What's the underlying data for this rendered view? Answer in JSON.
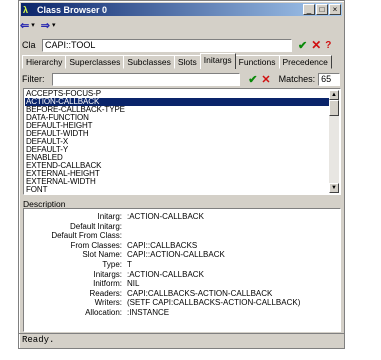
{
  "window": {
    "title": "Class Browser 0",
    "icon": "lambda-icon"
  },
  "class_field": {
    "label": "Cla",
    "value": "CAPI::TOOL"
  },
  "tabs": [
    "Hierarchy",
    "Superclasses",
    "Subclasses",
    "Slots",
    "Initargs",
    "Functions",
    "Precedence"
  ],
  "active_tab": "Initargs",
  "filter": {
    "label": "Filter:",
    "value": "",
    "matches_label": "Matches:",
    "matches_value": "65"
  },
  "initargs": [
    "ACCEPTS-FOCUS-P",
    "ACTION-CALLBACK",
    "BEFORE-CALLBACK-TYPE",
    "DATA-FUNCTION",
    "DEFAULT-HEIGHT",
    "DEFAULT-WIDTH",
    "DEFAULT-X",
    "DEFAULT-Y",
    "ENABLED",
    "EXTEND-CALLBACK",
    "EXTERNAL-HEIGHT",
    "EXTERNAL-WIDTH",
    "FONT"
  ],
  "selected_index": 1,
  "description": {
    "label": "Description",
    "rows": [
      {
        "key": "Initarg",
        "value": ":ACTION-CALLBACK"
      },
      {
        "key": "Default Initarg",
        "value": ""
      },
      {
        "key": "Default From Class",
        "value": ""
      },
      {
        "key": "From Classes",
        "value": "CAPI::CALLBACKS"
      },
      {
        "key": "Slot Name",
        "value": "CAPI::ACTION-CALLBACK"
      },
      {
        "key": "Type",
        "value": "T"
      },
      {
        "key": "Initargs",
        "value": ":ACTION-CALLBACK"
      },
      {
        "key": "Initform",
        "value": "NIL"
      },
      {
        "key": "Readers",
        "value": "CAPI:CALLBACKS-ACTION-CALLBACK"
      },
      {
        "key": "Writers",
        "value": "(SETF CAPI:CALLBACKS-ACTION-CALLBACK)"
      },
      {
        "key": "Allocation",
        "value": ":INSTANCE"
      }
    ]
  },
  "status": "Ready.",
  "colors": {
    "title_start": "#0a246a",
    "title_end": "#a6caf0",
    "selection": "#0a246a",
    "ok": "#0a8a0a",
    "cancel": "#d01010"
  }
}
